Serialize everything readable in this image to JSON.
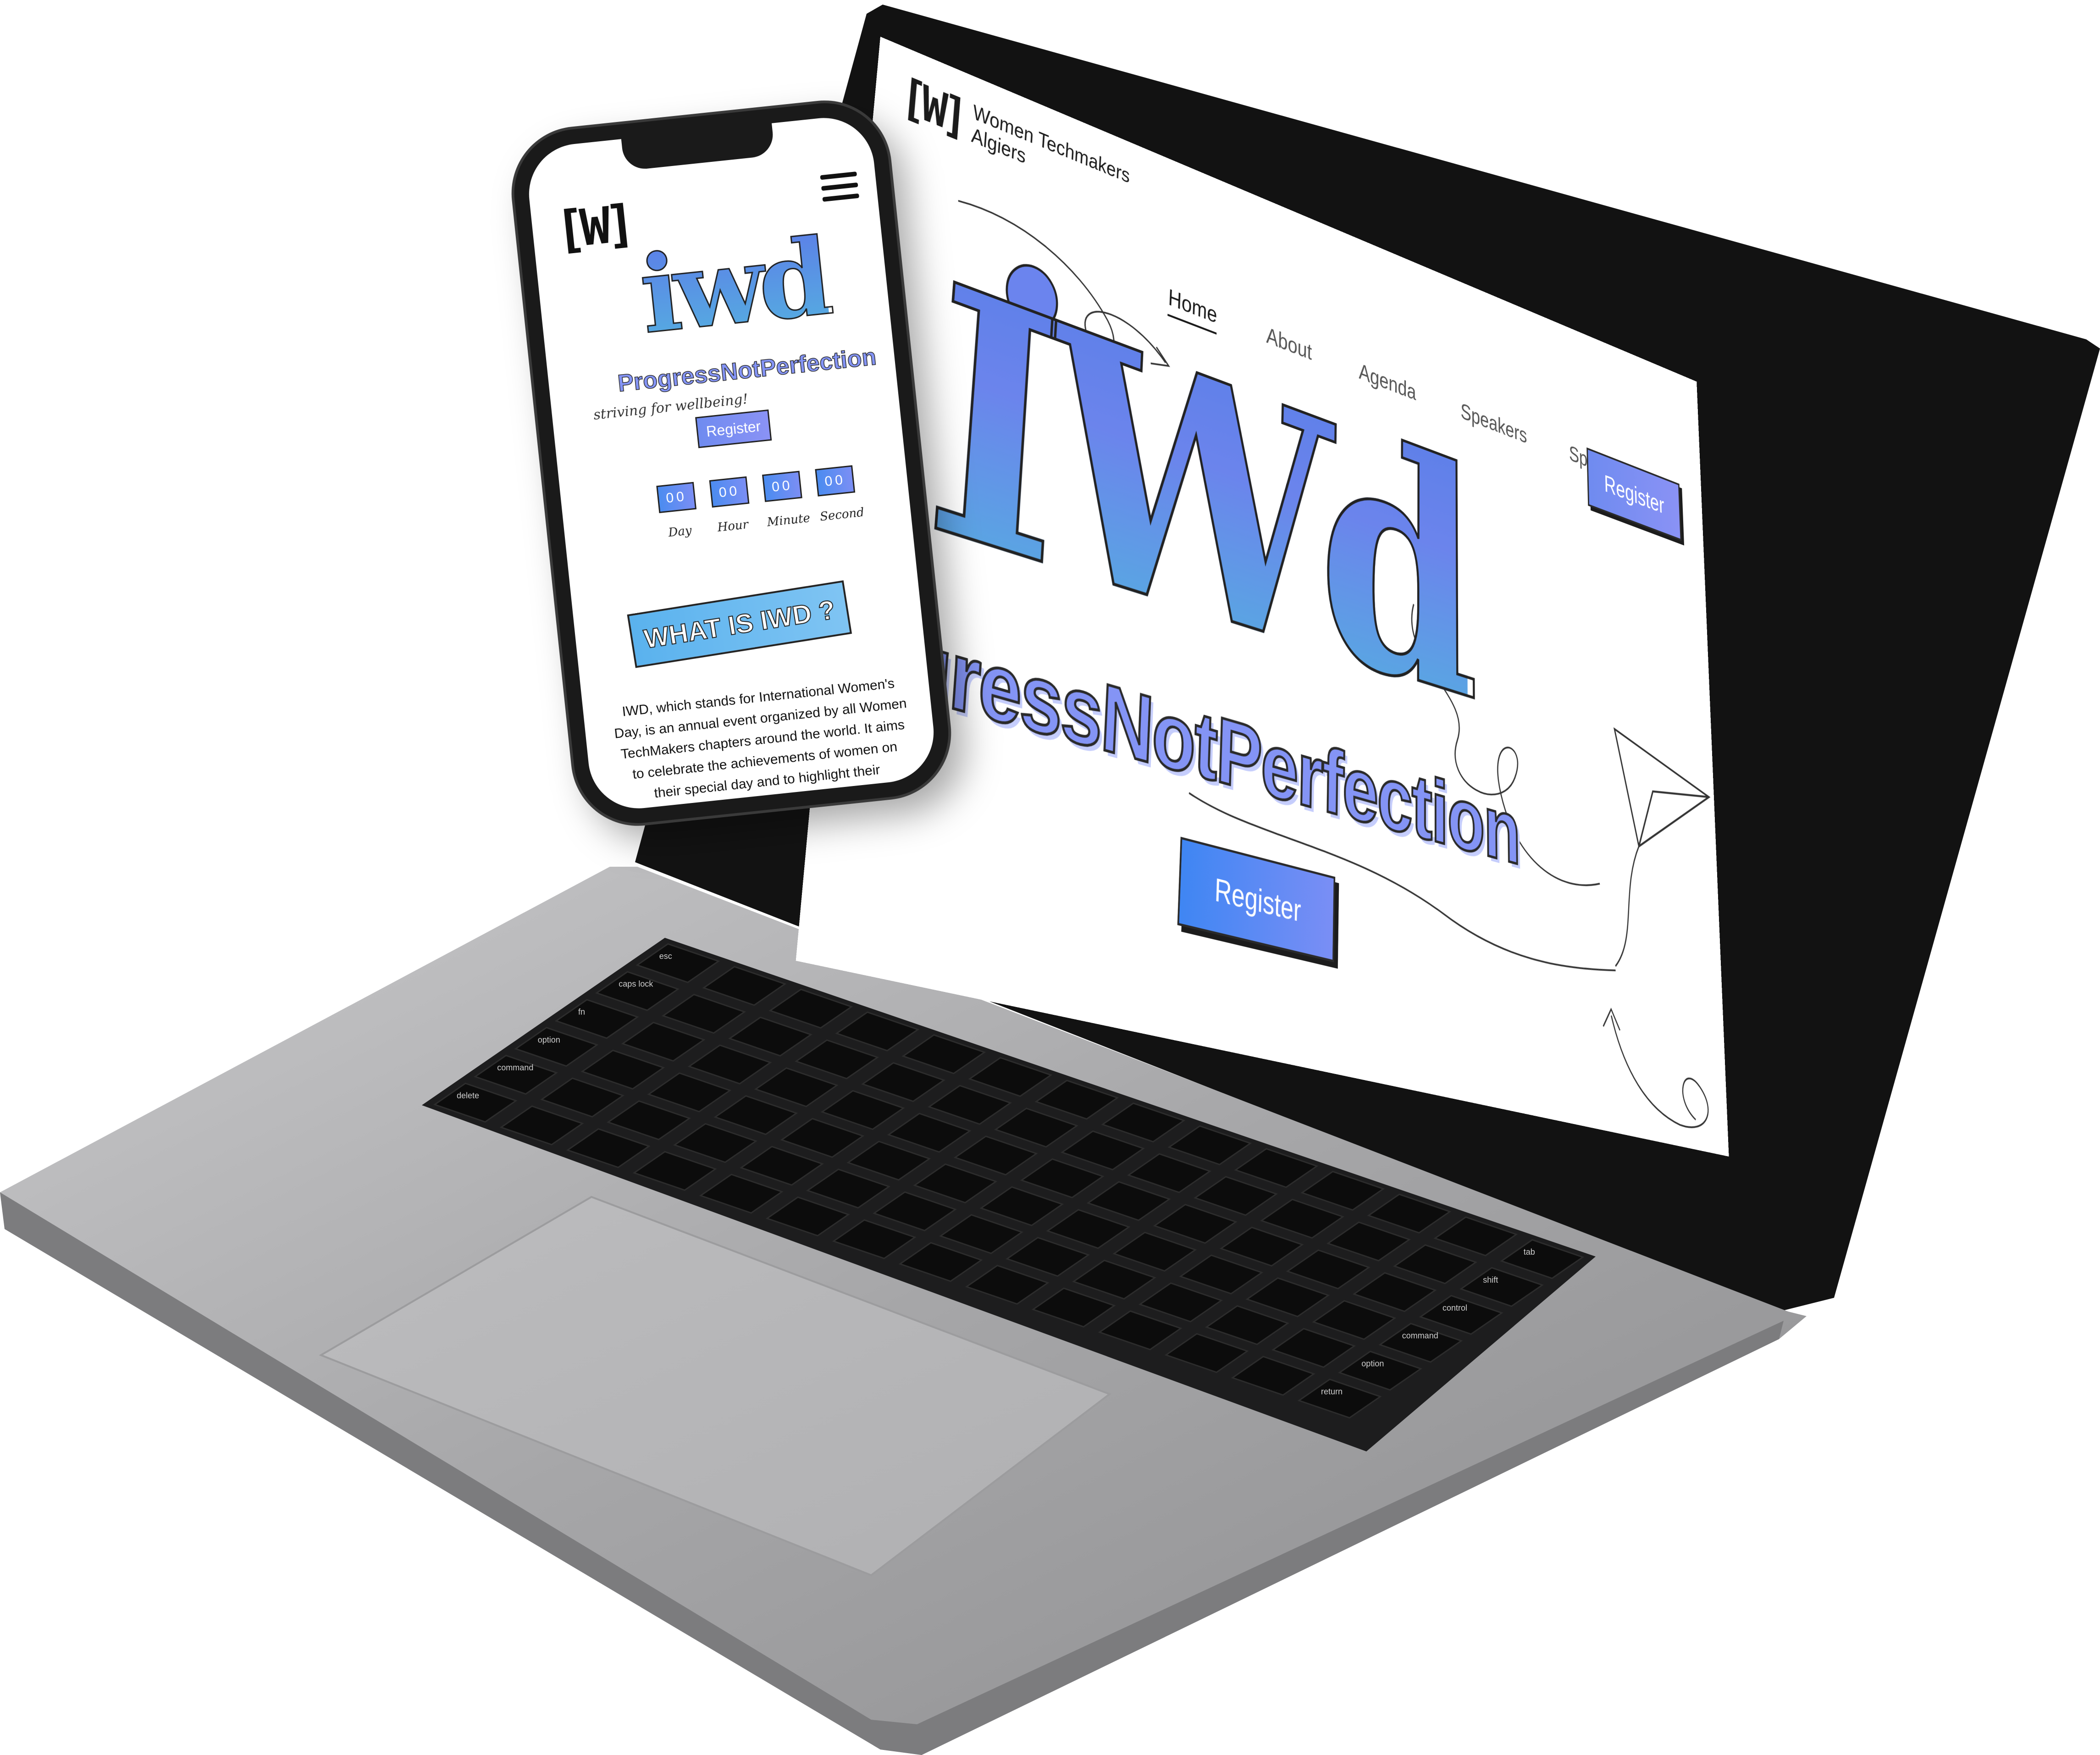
{
  "laptop_site": {
    "logo": {
      "mark": "[W]",
      "line1": "Women Techmakers",
      "line2": "Algiers"
    },
    "nav": [
      "Home",
      "About",
      "Agenda",
      "Speakers",
      "Sponsors"
    ],
    "register_top": "Register",
    "title": "IWd",
    "hashtag": "ProgressNotPerfection",
    "register_hero": "Register"
  },
  "phone_site": {
    "logo": "[W]",
    "title": "iwd",
    "hashtag": "ProgressNotPerfection",
    "tagline": "striving for wellbeing!",
    "register": "Register",
    "countdown": [
      {
        "value": "00",
        "label": "Day"
      },
      {
        "value": "00",
        "label": "Hour"
      },
      {
        "value": "00",
        "label": "Minute"
      },
      {
        "value": "00",
        "label": "Second"
      }
    ],
    "section_title": "WHAT IS IWD ?",
    "paragraph": "IWD, which stands for International Women's Day, is an annual event organized by all Women TechMakers chapters around the world. It aims to celebrate the achievements of women on their special day and to highlight their contribution to the communities."
  },
  "keyboard": {
    "keys": [
      "esc",
      "tab",
      "caps lock",
      "shift",
      "fn",
      "control",
      "option",
      "command",
      "command",
      "option",
      "delete",
      "return",
      "shift"
    ]
  },
  "colors": {
    "accent_blue": "#6f8bf0",
    "accent_cyan": "#55aee0",
    "hashtag_violet": "#8494f5",
    "laptop_body": "#a7a7a9"
  }
}
